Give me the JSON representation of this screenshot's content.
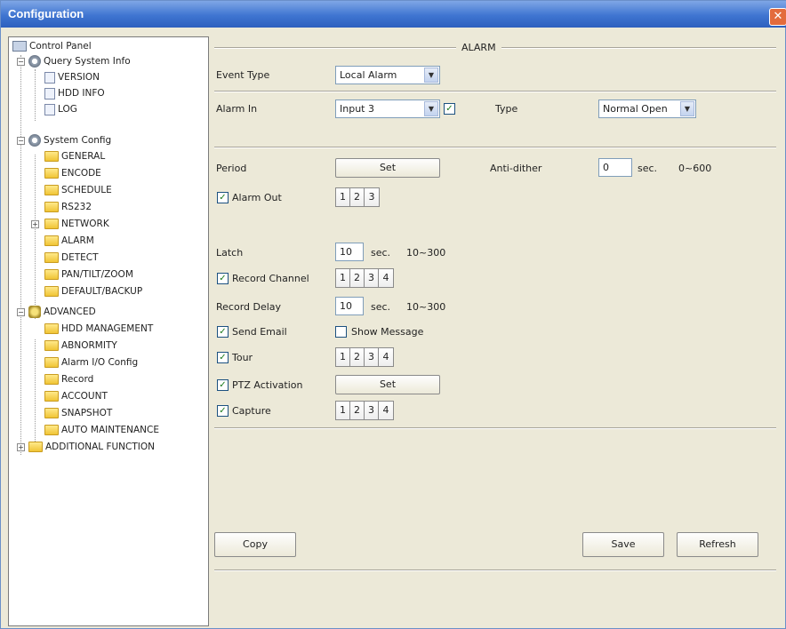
{
  "window": {
    "title": "Configuration",
    "close_glyph": "✕"
  },
  "tree": {
    "items": [
      {
        "label": "Control Panel",
        "icon": "panel-icon"
      },
      {
        "label": "Query System Info",
        "icon": "gear-icon"
      },
      {
        "label": "VERSION",
        "icon": "doc-icon"
      },
      {
        "label": "HDD INFO",
        "icon": "doc-icon"
      },
      {
        "label": "LOG",
        "icon": "doc-icon"
      },
      {
        "label": "System Config",
        "icon": "gear-icon"
      },
      {
        "label": "GENERAL",
        "icon": "folder-icon"
      },
      {
        "label": "ENCODE",
        "icon": "folder-icon"
      },
      {
        "label": "SCHEDULE",
        "icon": "folder-icon"
      },
      {
        "label": "RS232",
        "icon": "folder-icon"
      },
      {
        "label": "NETWORK",
        "icon": "folder-icon"
      },
      {
        "label": "ALARM",
        "icon": "folder-icon"
      },
      {
        "label": "DETECT",
        "icon": "folder-icon"
      },
      {
        "label": "PAN/TILT/ZOOM",
        "icon": "folder-icon"
      },
      {
        "label": "DEFAULT/BACKUP",
        "icon": "folder-icon"
      },
      {
        "label": "ADVANCED",
        "icon": "star-icon"
      },
      {
        "label": "HDD MANAGEMENT",
        "icon": "folder-icon"
      },
      {
        "label": "ABNORMITY",
        "icon": "folder-icon"
      },
      {
        "label": "Alarm I/O Config",
        "icon": "folder-icon"
      },
      {
        "label": "Record",
        "icon": "folder-icon"
      },
      {
        "label": "ACCOUNT",
        "icon": "folder-icon"
      },
      {
        "label": "SNAPSHOT",
        "icon": "folder-icon"
      },
      {
        "label": "AUTO MAINTENANCE",
        "icon": "folder-icon"
      },
      {
        "label": "ADDITIONAL FUNCTION",
        "icon": "folder-icon"
      }
    ],
    "expand_glyph_open": "−",
    "expand_glyph_closed": "+"
  },
  "alarm": {
    "section_title": "ALARM",
    "event_type_label": "Event Type",
    "event_type_value": "Local Alarm",
    "alarm_in_label": "Alarm In",
    "alarm_in_value": "Input 3",
    "alarm_in_enabled": "✓",
    "type_label": "Type",
    "type_value": "Normal Open",
    "period_label": "Period",
    "period_button": "Set",
    "anti_dither_label": "Anti-dither",
    "anti_dither_value": "0",
    "anti_dither_unit": "sec.",
    "anti_dither_range": "0~600",
    "alarm_out_label": "Alarm Out",
    "alarm_out_checked": "✓",
    "alarm_out_channels": [
      "1",
      "2",
      "3"
    ],
    "latch_label": "Latch",
    "latch_value": "10",
    "latch_unit": "sec.",
    "latch_range": "10~300",
    "record_channel_label": "Record Channel",
    "record_channel_checked": "✓",
    "record_channels": [
      "1",
      "2",
      "3",
      "4"
    ],
    "record_delay_label": "Record Delay",
    "record_delay_value": "10",
    "record_delay_unit": "sec.",
    "record_delay_range": "10~300",
    "send_email_label": "Send Email",
    "send_email_checked": "✓",
    "show_message_label": "Show Message",
    "tour_label": "Tour",
    "tour_checked": "✓",
    "tour_channels": [
      "1",
      "2",
      "3",
      "4"
    ],
    "ptz_label": "PTZ Activation",
    "ptz_checked": "✓",
    "ptz_button": "Set",
    "capture_label": "Capture",
    "capture_checked": "✓",
    "capture_channels": [
      "1",
      "2",
      "3",
      "4"
    ],
    "dropdown_glyph": "▼"
  },
  "footer": {
    "copy_label": "Copy",
    "save_label": "Save",
    "refresh_label": "Refresh"
  },
  "colors": {
    "titlebar": "#3f75d1",
    "panel": "#ece9d8",
    "check": "#1c7a1c"
  }
}
